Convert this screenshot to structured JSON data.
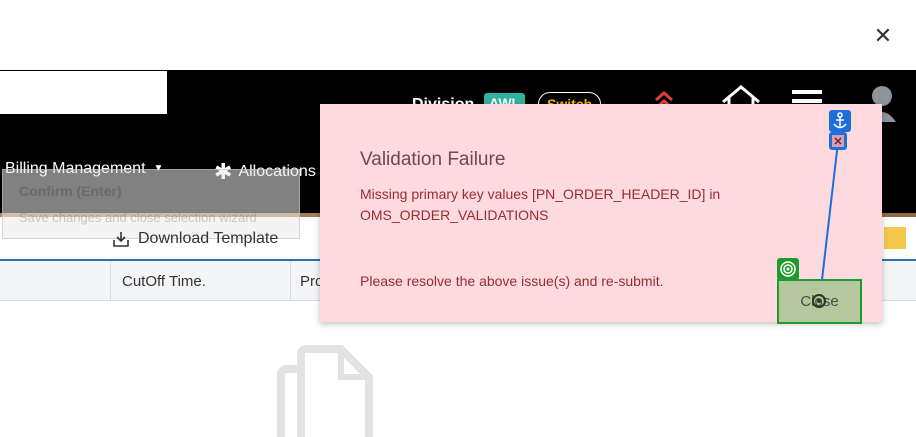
{
  "window": {
    "close_glyph": "✕"
  },
  "header": {
    "division_label": "Division",
    "division_value": "AWL",
    "switch_label": "Switch"
  },
  "nav": {
    "billing_label": "Billing Management",
    "allocations_label": "Allocations"
  },
  "confirm": {
    "title": "Confirm (Enter)",
    "subtitle": "Save changes and close selection wizard"
  },
  "toolbar": {
    "download_label": "Download Template"
  },
  "table": {
    "columns": [
      "CutOff Time.",
      "Pro"
    ]
  },
  "modal": {
    "title": "Validation Failure",
    "message": "Missing primary key values [PN_ORDER_HEADER_ID] in OMS_ORDER_VALIDATIONS",
    "resolve": "Please resolve the above issue(s) and re-submit.",
    "close_label": "Close"
  },
  "colors": {
    "modal_bg": "#fcdadd",
    "error_text": "#9a2a37",
    "accent_blue": "#2c6fb7",
    "division_badge": "#2fb39f",
    "switch_text": "#f4b400"
  },
  "icons": [
    "close-icon",
    "caret-down-icon",
    "asterisk-icon",
    "chevron-up-icon",
    "home-icon",
    "hamburger-menu-icon",
    "avatar-icon",
    "download-icon",
    "empty-file-icon",
    "anchor-icon",
    "target-icon"
  ]
}
